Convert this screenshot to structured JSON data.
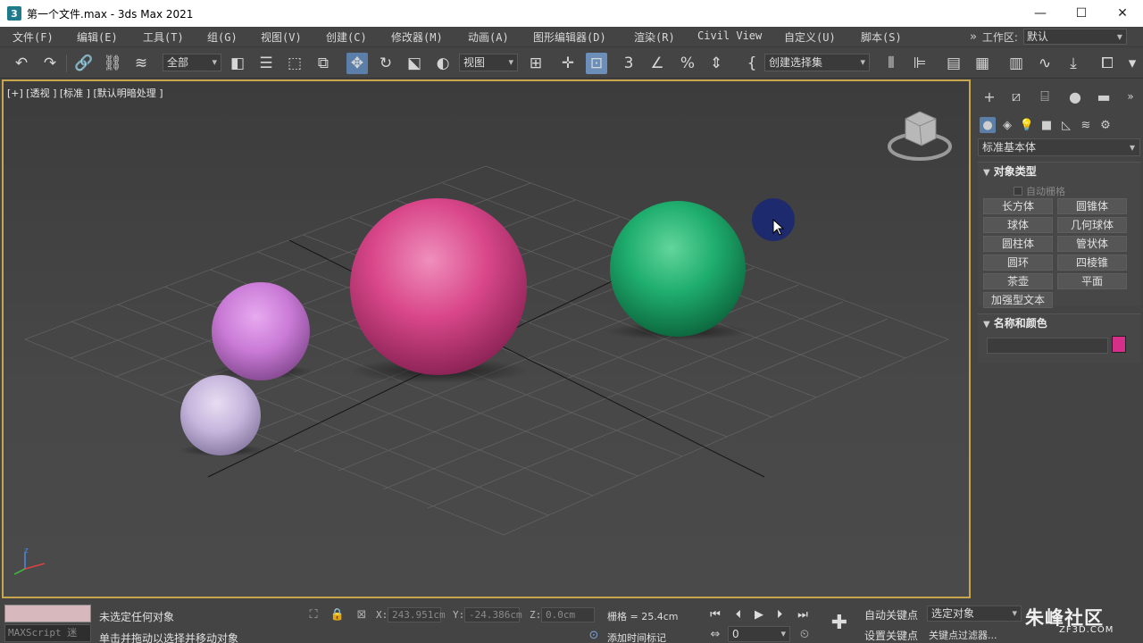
{
  "window": {
    "title": "第一个文件.max - 3ds Max 2021",
    "app_icon": "3",
    "minimize": "—",
    "maximize": "☐",
    "close": "✕"
  },
  "menu": {
    "items": [
      "文件(F)",
      "编辑(E)",
      "工具(T)",
      "组(G)",
      "视图(V)",
      "创建(C)",
      "修改器(M)",
      "动画(A)",
      "图形编辑器(D)",
      "渲染(R)",
      "Civil View",
      "自定义(U)",
      "脚本(S)"
    ],
    "overflow": "»",
    "workspace_label": "工作区:",
    "workspace_value": "默认"
  },
  "toolbar": {
    "selection_filter": "全部",
    "ref_coord": "视图",
    "named_selection": "创建选择集"
  },
  "viewport": {
    "label": "[+] [透视 ] [标准 ] [默认明暗处理 ]",
    "axis_z": "z",
    "spheres": [
      {
        "name": "pink-large",
        "color": "#d9478a"
      },
      {
        "name": "green",
        "color": "#1fae6e"
      },
      {
        "name": "violet",
        "color": "#c97ad6"
      },
      {
        "name": "lavender",
        "color": "#c5b5dc"
      }
    ]
  },
  "command_panel": {
    "category": "标准基本体",
    "object_type_title": "对象类型",
    "autogrid": "自动栅格",
    "buttons": [
      "长方体",
      "圆锥体",
      "球体",
      "几何球体",
      "圆柱体",
      "管状体",
      "圆环",
      "四棱锥",
      "茶壶",
      "平面",
      "加强型文本"
    ],
    "name_color_title": "名称和颜色",
    "object_color": "#d62f8a"
  },
  "status": {
    "maxscript": "MAXScript 迷",
    "line1": "未选定任何对象",
    "line2": "单击并拖动以选择并移动对象",
    "x_label": "X:",
    "x_value": "243.951cm",
    "y_label": "Y:",
    "y_value": "-24.386cm",
    "z_label": "Z:",
    "z_value": "0.0cm",
    "grid": "栅格 = 25.4cm",
    "add_time_tag": "添加时间标记",
    "auto_key": "自动关键点",
    "set_key": "设置关键点",
    "selected_object": "选定对象",
    "key_filters": "关键点过滤器...",
    "frame": "0"
  },
  "watermark": {
    "main": "朱峰社区",
    "sub": "ZF3D.COM"
  }
}
